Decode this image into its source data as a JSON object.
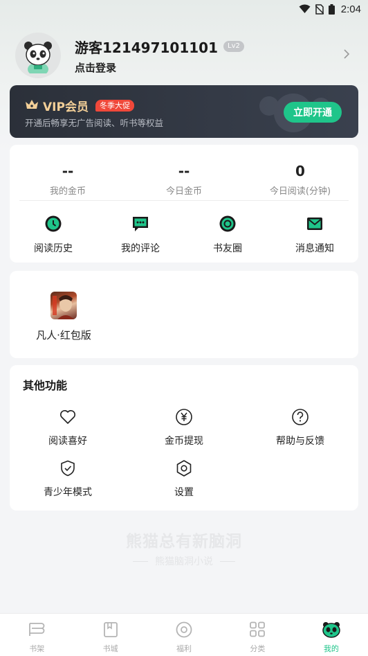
{
  "status_bar": {
    "time": "2:04"
  },
  "profile": {
    "username": "游客121497101101",
    "level": "Lv2",
    "login_hint": "点击登录"
  },
  "vip": {
    "title": "VIP会员",
    "promo_badge": "冬季大促",
    "description": "开通后畅享无广告阅读、听书等权益",
    "button_label": "立即开通",
    "accent_color": "#1fc58a",
    "gold_color": "#f3cf97"
  },
  "stats": [
    {
      "value": "--",
      "label": "我的金币"
    },
    {
      "value": "--",
      "label": "今日金币"
    },
    {
      "value": "0",
      "label": "今日阅读(分钟)"
    }
  ],
  "quick_actions": [
    {
      "label": "阅读历史",
      "icon": "clock-icon"
    },
    {
      "label": "我的评论",
      "icon": "comment-icon"
    },
    {
      "label": "书友圈",
      "icon": "circle-icon"
    },
    {
      "label": "消息通知",
      "icon": "mail-icon"
    }
  ],
  "book": {
    "title": "凡人·红包版"
  },
  "other_functions": {
    "title": "其他功能",
    "items": [
      {
        "label": "阅读喜好",
        "icon": "heart-icon"
      },
      {
        "label": "金币提现",
        "icon": "yuan-icon"
      },
      {
        "label": "帮助与反馈",
        "icon": "help-icon"
      },
      {
        "label": "青少年模式",
        "icon": "shield-icon"
      },
      {
        "label": "设置",
        "icon": "gear-icon"
      }
    ]
  },
  "slogan": {
    "main": "熊猫总有新脑洞",
    "sub": "熊猫脑洞小说"
  },
  "tabbar": [
    {
      "label": "书架",
      "icon": "bookshelf-icon",
      "active": false
    },
    {
      "label": "书城",
      "icon": "bookstore-icon",
      "active": false
    },
    {
      "label": "福利",
      "icon": "welfare-icon",
      "active": false
    },
    {
      "label": "分类",
      "icon": "category-icon",
      "active": false
    },
    {
      "label": "我的",
      "icon": "panda-icon",
      "active": true
    }
  ]
}
